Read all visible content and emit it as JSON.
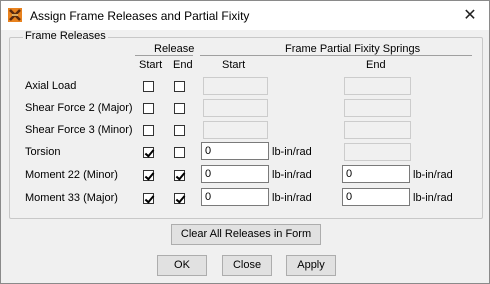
{
  "window": {
    "title": "Assign Frame Releases and Partial Fixity",
    "close_glyph": "✕"
  },
  "group": {
    "title": "Frame Releases",
    "release_header": "Release",
    "fixity_header": "Frame Partial Fixity Springs",
    "col_start": "Start",
    "col_end": "End",
    "fixity_start": "Start",
    "fixity_end": "End"
  },
  "rows": [
    {
      "label": "Axial Load",
      "release_start": false,
      "release_end": false,
      "start_value": "",
      "start_unit": "",
      "start_enabled": false,
      "end_value": "",
      "end_unit": "",
      "end_enabled": false
    },
    {
      "label": "Shear Force 2 (Major)",
      "release_start": false,
      "release_end": false,
      "start_value": "",
      "start_unit": "",
      "start_enabled": false,
      "end_value": "",
      "end_unit": "",
      "end_enabled": false
    },
    {
      "label": "Shear Force 3 (Minor)",
      "release_start": false,
      "release_end": false,
      "start_value": "",
      "start_unit": "",
      "start_enabled": false,
      "end_value": "",
      "end_unit": "",
      "end_enabled": false
    },
    {
      "label": "Torsion",
      "release_start": true,
      "release_end": false,
      "start_value": "0",
      "start_unit": "lb-in/rad",
      "start_enabled": true,
      "end_value": "",
      "end_unit": "",
      "end_enabled": false
    },
    {
      "label": "Moment 22 (Minor)",
      "release_start": true,
      "release_end": true,
      "start_value": "0",
      "start_unit": "lb-in/rad",
      "start_enabled": true,
      "end_value": "0",
      "end_unit": "lb-in/rad",
      "end_enabled": true
    },
    {
      "label": "Moment 33 (Major)",
      "release_start": true,
      "release_end": true,
      "start_value": "0",
      "start_unit": "lb-in/rad",
      "start_enabled": true,
      "end_value": "0",
      "end_unit": "lb-in/rad",
      "end_enabled": true
    }
  ],
  "buttons": {
    "clear": "Clear All Releases in Form",
    "ok": "OK",
    "close": "Close",
    "apply": "Apply"
  },
  "colors": {
    "dialog_bg": "#f0f0f0",
    "titlebar_bg": "#ffffff",
    "icon_orange": "#e8821e",
    "icon_dark": "#5a2a10"
  }
}
